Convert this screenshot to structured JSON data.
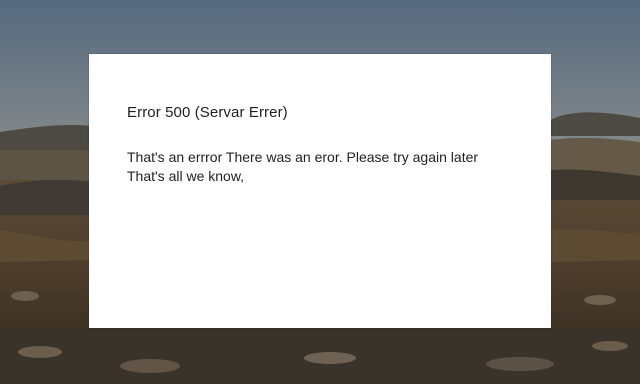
{
  "error_page": {
    "title": "Error 500 (Servar Errer)",
    "message_line_1": "That's an errror There was an eror. Please try again later",
    "message_line_2": "That's all we know,"
  },
  "colors": {
    "sky_top": "#5f7388",
    "sky_horizon": "#b9a487",
    "ground": "#4a3d2e",
    "card_background": "#ffffff",
    "text": "#222222"
  }
}
